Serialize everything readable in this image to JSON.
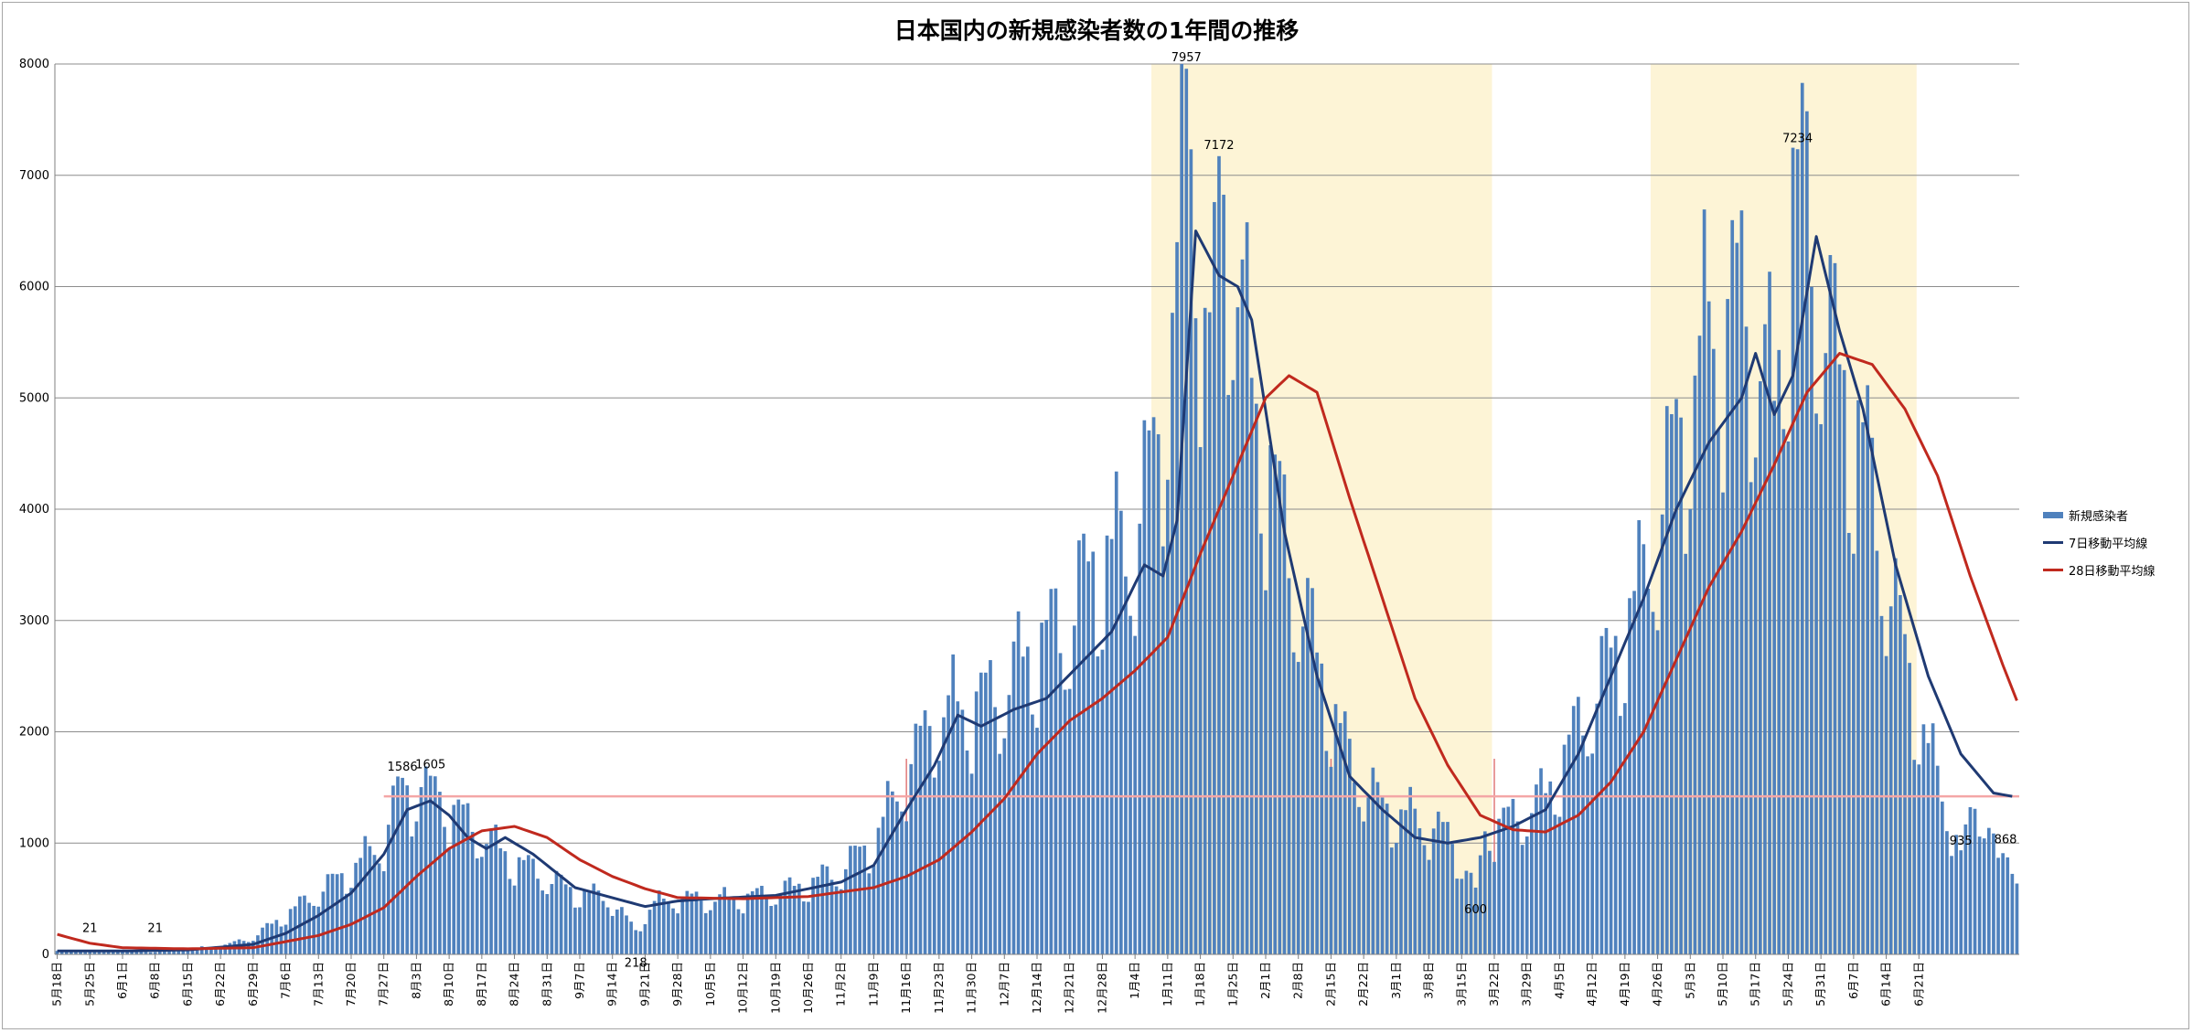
{
  "chart_data": {
    "type": "bar",
    "title": "日本国内の新規感染者数の1年間の推移",
    "ylim": [
      0,
      8000
    ],
    "yticks": [
      0,
      1000,
      2000,
      3000,
      4000,
      5000,
      6000,
      7000,
      8000
    ],
    "start_date": "2020-05-18",
    "days": 400,
    "x_tick_labels": [
      "5月18日",
      "5月25日",
      "6月1日",
      "6月8日",
      "6月15日",
      "6月22日",
      "6月29日",
      "7月6日",
      "7月13日",
      "7月20日",
      "7月27日",
      "8月3日",
      "8月10日",
      "8月17日",
      "8月24日",
      "8月31日",
      "9月7日",
      "9月14日",
      "9月21日",
      "9月28日",
      "10月5日",
      "10月12日",
      "10月19日",
      "10月26日",
      "11月2日",
      "11月9日",
      "11月16日",
      "11月23日",
      "11月30日",
      "12月7日",
      "12月14日",
      "12月21日",
      "12月28日",
      "1月4日",
      "1月11日",
      "1月18日",
      "1月25日",
      "2月1日",
      "2月8日",
      "2月15日",
      "2月22日",
      "3月1日",
      "3月8日",
      "3月15日",
      "3月22日",
      "3月29日",
      "4月5日",
      "4月12日",
      "4月19日",
      "4月26日",
      "5月3日",
      "5月10日",
      "5月17日",
      "5月24日",
      "5月31日",
      "6月7日",
      "6月14日",
      "6月21日"
    ],
    "shaded_periods": [
      {
        "from": "1月8日",
        "to": "3月21日"
      },
      {
        "from": "4月25日",
        "to": "6月20日"
      }
    ],
    "reference_line": {
      "value": 1420,
      "color": "#f4a6a6"
    },
    "vertical_markers": [
      "11月16日",
      "2月15日",
      "3月22日"
    ],
    "series": [
      {
        "name": "新規感染者",
        "kind": "bar",
        "color": "#4f81bd",
        "anchors": [
          [
            0,
            40
          ],
          [
            7,
            21
          ],
          [
            14,
            40
          ],
          [
            21,
            21
          ],
          [
            28,
            50
          ],
          [
            35,
            70
          ],
          [
            42,
            150
          ],
          [
            49,
            350
          ],
          [
            56,
            550
          ],
          [
            63,
            750
          ],
          [
            70,
            1000
          ],
          [
            74,
            1586
          ],
          [
            76,
            1400
          ],
          [
            80,
            1605
          ],
          [
            84,
            1300
          ],
          [
            90,
            1100
          ],
          [
            97,
            850
          ],
          [
            104,
            700
          ],
          [
            111,
            550
          ],
          [
            118,
            500
          ],
          [
            124,
            218
          ],
          [
            128,
            450
          ],
          [
            133,
            500
          ],
          [
            140,
            480
          ],
          [
            147,
            500
          ],
          [
            154,
            550
          ],
          [
            161,
            620
          ],
          [
            168,
            750
          ],
          [
            175,
            1000
          ],
          [
            182,
            1600
          ],
          [
            188,
            2100
          ],
          [
            195,
            2200
          ],
          [
            202,
            2300
          ],
          [
            209,
            2700
          ],
          [
            216,
            2900
          ],
          [
            223,
            3500
          ],
          [
            230,
            3600
          ],
          [
            236,
            4500
          ],
          [
            240,
            6000
          ],
          [
            242,
            7957
          ],
          [
            247,
            5000
          ],
          [
            249,
            7172
          ],
          [
            256,
            5000
          ],
          [
            263,
            3700
          ],
          [
            270,
            2600
          ],
          [
            277,
            1700
          ],
          [
            284,
            1300
          ],
          [
            291,
            1200
          ],
          [
            298,
            1050
          ],
          [
            304,
            600
          ],
          [
            306,
            1100
          ],
          [
            312,
            1200
          ],
          [
            319,
            1400
          ],
          [
            326,
            2000
          ],
          [
            333,
            2600
          ],
          [
            340,
            3300
          ],
          [
            347,
            4500
          ],
          [
            354,
            5500
          ],
          [
            361,
            5800
          ],
          [
            364,
            5400
          ],
          [
            368,
            4800
          ],
          [
            373,
            7234
          ],
          [
            375,
            6500
          ],
          [
            381,
            5200
          ],
          [
            387,
            4500
          ],
          [
            394,
            3000
          ],
          [
            401,
            1800
          ],
          [
            408,
            935
          ],
          [
            412,
            1400
          ],
          [
            416,
            868
          ]
        ]
      },
      {
        "name": "7日移動平均線",
        "kind": "line",
        "color": "#1f3a73",
        "anchors": [
          [
            0,
            30
          ],
          [
            14,
            30
          ],
          [
            28,
            40
          ],
          [
            42,
            90
          ],
          [
            49,
            190
          ],
          [
            56,
            350
          ],
          [
            63,
            550
          ],
          [
            70,
            900
          ],
          [
            75,
            1300
          ],
          [
            80,
            1380
          ],
          [
            84,
            1250
          ],
          [
            88,
            1050
          ],
          [
            92,
            950
          ],
          [
            96,
            1050
          ],
          [
            102,
            900
          ],
          [
            111,
            600
          ],
          [
            118,
            520
          ],
          [
            126,
            430
          ],
          [
            133,
            480
          ],
          [
            140,
            500
          ],
          [
            154,
            530
          ],
          [
            168,
            650
          ],
          [
            175,
            800
          ],
          [
            182,
            1300
          ],
          [
            188,
            1700
          ],
          [
            193,
            2150
          ],
          [
            198,
            2050
          ],
          [
            205,
            2200
          ],
          [
            212,
            2300
          ],
          [
            219,
            2600
          ],
          [
            226,
            2900
          ],
          [
            233,
            3500
          ],
          [
            237,
            3400
          ],
          [
            240,
            3900
          ],
          [
            244,
            6500
          ],
          [
            249,
            6100
          ],
          [
            253,
            6000
          ],
          [
            256,
            5700
          ],
          [
            263,
            3800
          ],
          [
            270,
            2500
          ],
          [
            277,
            1600
          ],
          [
            284,
            1300
          ],
          [
            291,
            1050
          ],
          [
            298,
            1000
          ],
          [
            305,
            1050
          ],
          [
            312,
            1150
          ],
          [
            319,
            1300
          ],
          [
            326,
            1800
          ],
          [
            333,
            2500
          ],
          [
            340,
            3200
          ],
          [
            347,
            4000
          ],
          [
            354,
            4600
          ],
          [
            361,
            5000
          ],
          [
            364,
            5400
          ],
          [
            368,
            4850
          ],
          [
            372,
            5200
          ],
          [
            377,
            6450
          ],
          [
            382,
            5600
          ],
          [
            387,
            4900
          ],
          [
            394,
            3500
          ],
          [
            401,
            2500
          ],
          [
            408,
            1800
          ],
          [
            415,
            1450
          ],
          [
            419,
            1420
          ]
        ]
      },
      {
        "name": "28日移動平均線",
        "kind": "line",
        "color": "#c0291e",
        "anchors": [
          [
            0,
            180
          ],
          [
            7,
            100
          ],
          [
            14,
            60
          ],
          [
            28,
            50
          ],
          [
            42,
            60
          ],
          [
            56,
            170
          ],
          [
            63,
            270
          ],
          [
            70,
            420
          ],
          [
            77,
            700
          ],
          [
            84,
            950
          ],
          [
            91,
            1110
          ],
          [
            98,
            1150
          ],
          [
            105,
            1050
          ],
          [
            112,
            850
          ],
          [
            119,
            700
          ],
          [
            126,
            590
          ],
          [
            133,
            510
          ],
          [
            147,
            500
          ],
          [
            161,
            520
          ],
          [
            175,
            600
          ],
          [
            182,
            700
          ],
          [
            189,
            850
          ],
          [
            196,
            1100
          ],
          [
            203,
            1400
          ],
          [
            210,
            1800
          ],
          [
            217,
            2100
          ],
          [
            224,
            2300
          ],
          [
            231,
            2550
          ],
          [
            238,
            2850
          ],
          [
            245,
            3600
          ],
          [
            252,
            4300
          ],
          [
            259,
            5000
          ],
          [
            264,
            5200
          ],
          [
            270,
            5050
          ],
          [
            277,
            4100
          ],
          [
            284,
            3200
          ],
          [
            291,
            2300
          ],
          [
            298,
            1700
          ],
          [
            305,
            1250
          ],
          [
            312,
            1120
          ],
          [
            319,
            1100
          ],
          [
            326,
            1250
          ],
          [
            333,
            1550
          ],
          [
            340,
            2000
          ],
          [
            347,
            2650
          ],
          [
            354,
            3300
          ],
          [
            361,
            3800
          ],
          [
            368,
            4400
          ],
          [
            375,
            5050
          ],
          [
            382,
            5400
          ],
          [
            389,
            5300
          ],
          [
            396,
            4900
          ],
          [
            403,
            4300
          ],
          [
            410,
            3400
          ],
          [
            417,
            2600
          ],
          [
            420,
            2280
          ]
        ]
      }
    ],
    "data_labels": [
      {
        "x": 7,
        "value": "21"
      },
      {
        "x": 21,
        "value": "21"
      },
      {
        "x": 74,
        "value": "1586"
      },
      {
        "x": 80,
        "value": "1605"
      },
      {
        "x": 124,
        "value": "218"
      },
      {
        "x": 242,
        "value": "7957"
      },
      {
        "x": 249,
        "value": "7172"
      },
      {
        "x": 304,
        "value": "600"
      },
      {
        "x": 373,
        "value": "7234"
      },
      {
        "x": 408,
        "value": "935"
      },
      {
        "x": 416,
        "value": "868"
      }
    ],
    "legend_position": "right",
    "grid": true
  }
}
